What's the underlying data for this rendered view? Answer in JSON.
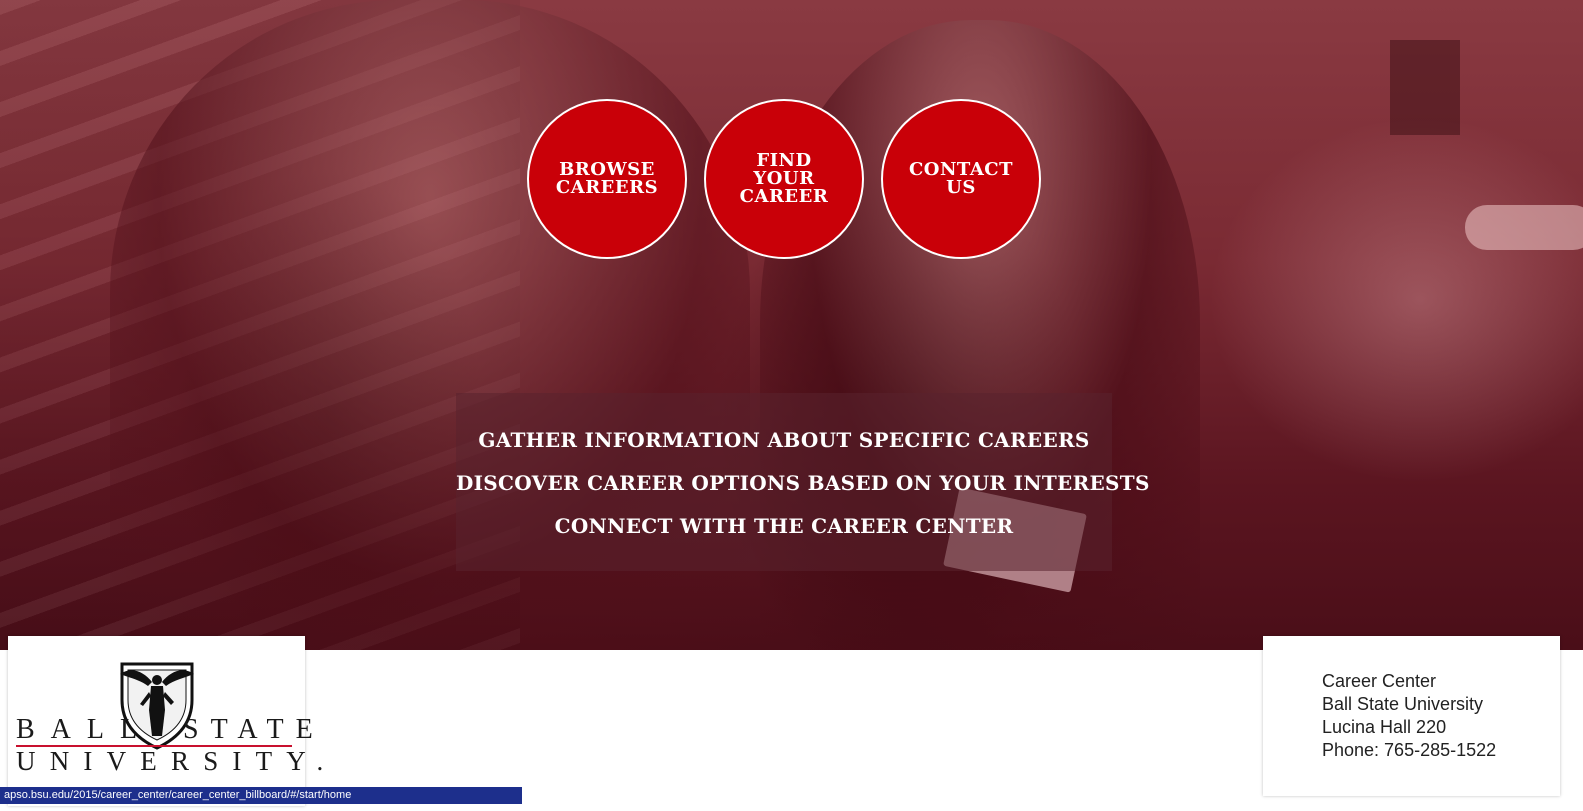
{
  "nav": {
    "browse_label": "BROWSE CAREERS",
    "find_label": "FIND YOUR CAREER",
    "contact_label": "CONTACT US"
  },
  "info": {
    "line1": "GATHER INFORMATION ABOUT SPECIFIC CAREERS",
    "line2": "DISCOVER CAREER OPTIONS BASED ON YOUR INTERESTS",
    "line3": "CONNECT WITH THE CAREER CENTER"
  },
  "logo": {
    "word_left": "BALL",
    "word_right": "STATE",
    "word_bottom": "UNIVERSITY.",
    "accent_color": "#c8102e"
  },
  "contact": {
    "name": "Career Center",
    "org": "Ball State University",
    "location": "Lucina Hall 220",
    "phone": "Phone: 765-285-1522"
  },
  "status": {
    "url": "apso.bsu.edu/2015/career_center/career_center_billboard/#/start/home"
  },
  "colors": {
    "button_red": "#c90008",
    "status_bar": "#1d2f8c"
  }
}
